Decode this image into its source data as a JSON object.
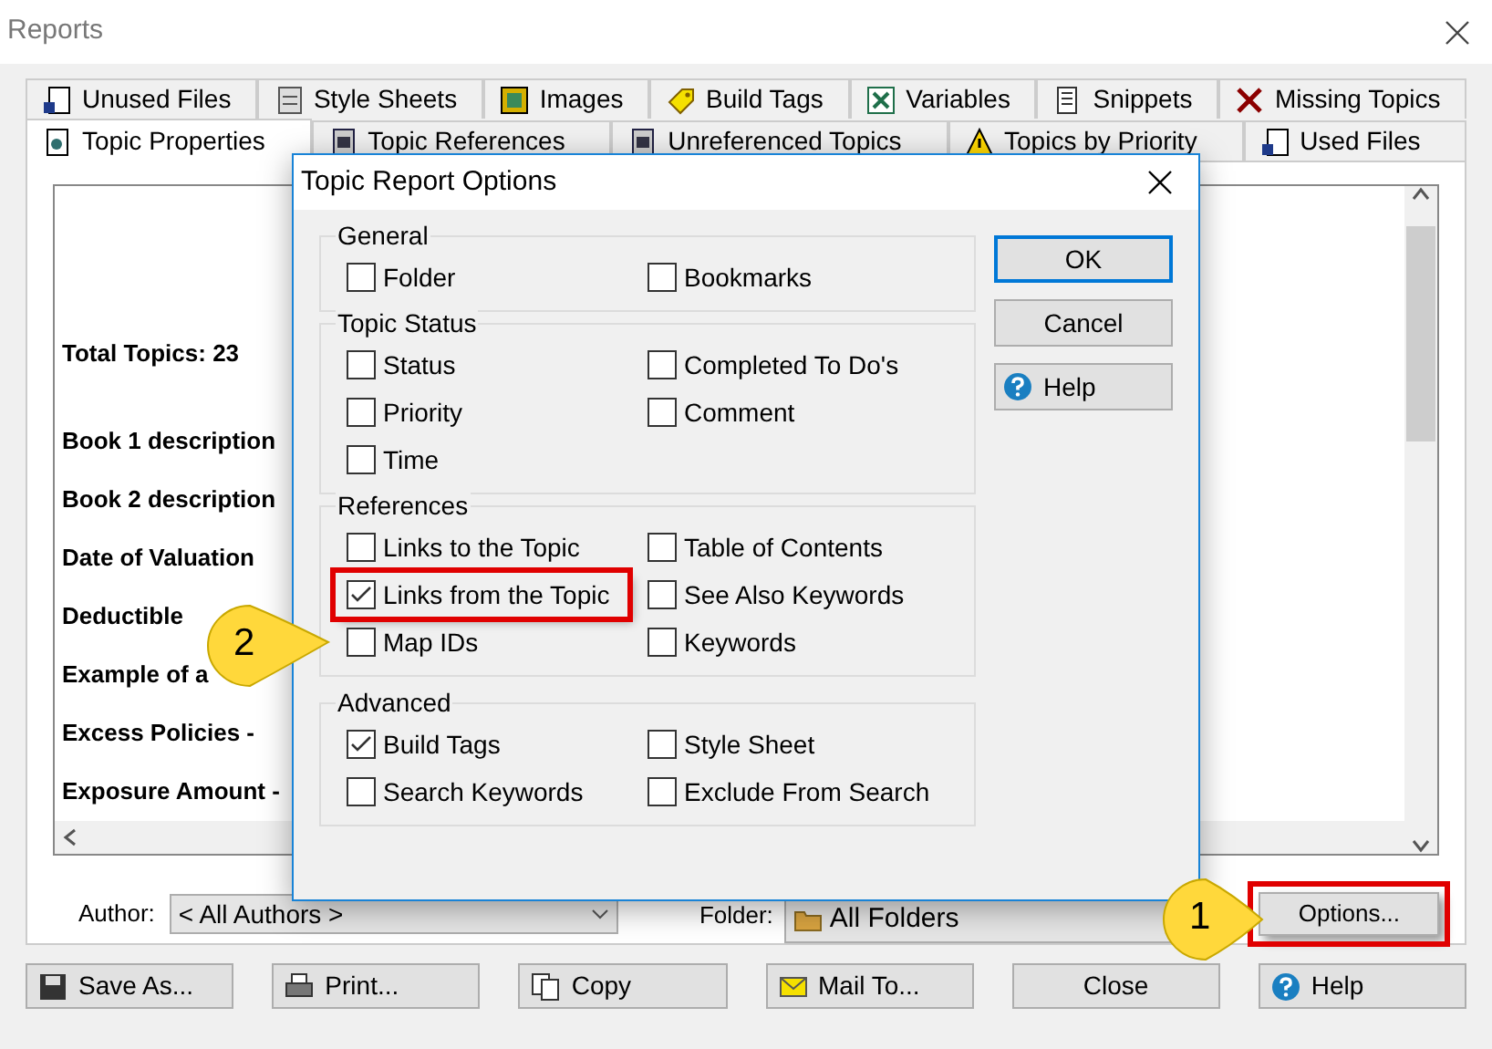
{
  "window": {
    "title": "Reports"
  },
  "tabs_row_1": [
    {
      "label": "Unused Files",
      "selected": false
    },
    {
      "label": "Style Sheets",
      "selected": false
    },
    {
      "label": "Images",
      "selected": false
    },
    {
      "label": "Build Tags",
      "selected": false
    },
    {
      "label": "Variables",
      "selected": false
    },
    {
      "label": "Snippets",
      "selected": false
    },
    {
      "label": "Missing Topics",
      "selected": false
    }
  ],
  "tabs_row_2": [
    {
      "label": "Topic Properties",
      "selected": true
    },
    {
      "label": "Topic References",
      "selected": false
    },
    {
      "label": "Unreferenced Topics",
      "selected": false
    },
    {
      "label": "Topics by Priority",
      "selected": false
    },
    {
      "label": "Used Files",
      "selected": false
    }
  ],
  "report": {
    "total": "Total Topics: 23",
    "lines": [
      "Book 1 description",
      "Book 2 description",
      "Date of Valuation",
      "Deductible",
      "Example of a",
      "Excess Policies -",
      "Exposure Amount -"
    ]
  },
  "filters": {
    "author_label": "Author:",
    "author_value": "< All Authors >",
    "folder_label": "Folder:",
    "folder_value": "All Folders",
    "options_button": {
      "label": "Options...",
      "highlighted": true
    }
  },
  "buttons": [
    "Save As...",
    "Print...",
    "Copy",
    "Mail To...",
    "Close",
    "Help"
  ],
  "dialog": {
    "title": "Topic Report Options",
    "groups": [
      {
        "title": "General",
        "items": [
          {
            "label": "Folder",
            "checked": false,
            "highlighted": false
          },
          {
            "label": "Bookmarks",
            "checked": false,
            "highlighted": false
          }
        ]
      },
      {
        "title": "Topic Status",
        "items": [
          {
            "label": "Status",
            "checked": false,
            "highlighted": false
          },
          {
            "label": "Completed To Do's",
            "checked": false,
            "highlighted": false
          },
          {
            "label": "Priority",
            "checked": false,
            "highlighted": false
          },
          {
            "label": "Comment",
            "checked": false,
            "highlighted": false
          },
          {
            "label": "Time",
            "checked": false,
            "highlighted": false
          }
        ]
      },
      {
        "title": "References",
        "items": [
          {
            "label": "Links to the Topic",
            "checked": false,
            "highlighted": false
          },
          {
            "label": "Table of Contents",
            "checked": false,
            "highlighted": false
          },
          {
            "label": "Links from the Topic",
            "checked": true,
            "highlighted": true
          },
          {
            "label": "See Also Keywords",
            "checked": false,
            "highlighted": false
          },
          {
            "label": "Map IDs",
            "checked": false,
            "highlighted": false
          },
          {
            "label": "Keywords",
            "checked": false,
            "highlighted": false
          }
        ]
      },
      {
        "title": "Advanced",
        "items": [
          {
            "label": "Build Tags",
            "checked": true,
            "highlighted": false
          },
          {
            "label": "Style Sheet",
            "checked": false,
            "highlighted": false
          },
          {
            "label": "Search Keywords",
            "checked": false,
            "highlighted": false
          },
          {
            "label": "Exclude From Search",
            "checked": false,
            "highlighted": false
          }
        ]
      }
    ],
    "buttons": [
      {
        "label": "OK",
        "default": true
      },
      {
        "label": "Cancel",
        "default": false
      },
      {
        "label": "Help",
        "default": false
      }
    ]
  },
  "callouts": [
    "1",
    "2"
  ]
}
